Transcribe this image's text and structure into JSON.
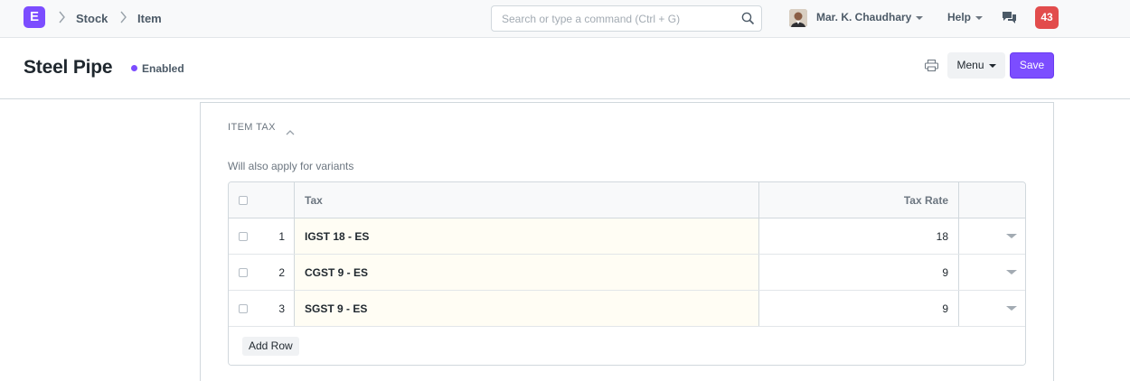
{
  "navbar": {
    "logo_letter": "E",
    "breadcrumbs": [
      "Stock",
      "Item"
    ],
    "search_placeholder": "Search or type a command (Ctrl + G)",
    "user_name": "Mar. K. Chaudhary",
    "help_label": "Help",
    "notification_count": "43"
  },
  "page": {
    "title": "Steel Pipe",
    "status": "Enabled",
    "menu_label": "Menu",
    "save_label": "Save"
  },
  "section": {
    "heading": "ITEM TAX",
    "description": "Will also apply for variants"
  },
  "table": {
    "columns": {
      "tax": "Tax",
      "rate": "Tax Rate"
    },
    "rows": [
      {
        "idx": "1",
        "tax": "IGST 18 - ES",
        "rate": "18"
      },
      {
        "idx": "2",
        "tax": "CGST 9 - ES",
        "rate": "9"
      },
      {
        "idx": "3",
        "tax": "SGST 9 - ES",
        "rate": "9"
      }
    ],
    "add_row_label": "Add Row"
  },
  "colors": {
    "accent": "#7c4dff",
    "badge": "#e24c4c",
    "editable_cell": "#fffdf4"
  }
}
